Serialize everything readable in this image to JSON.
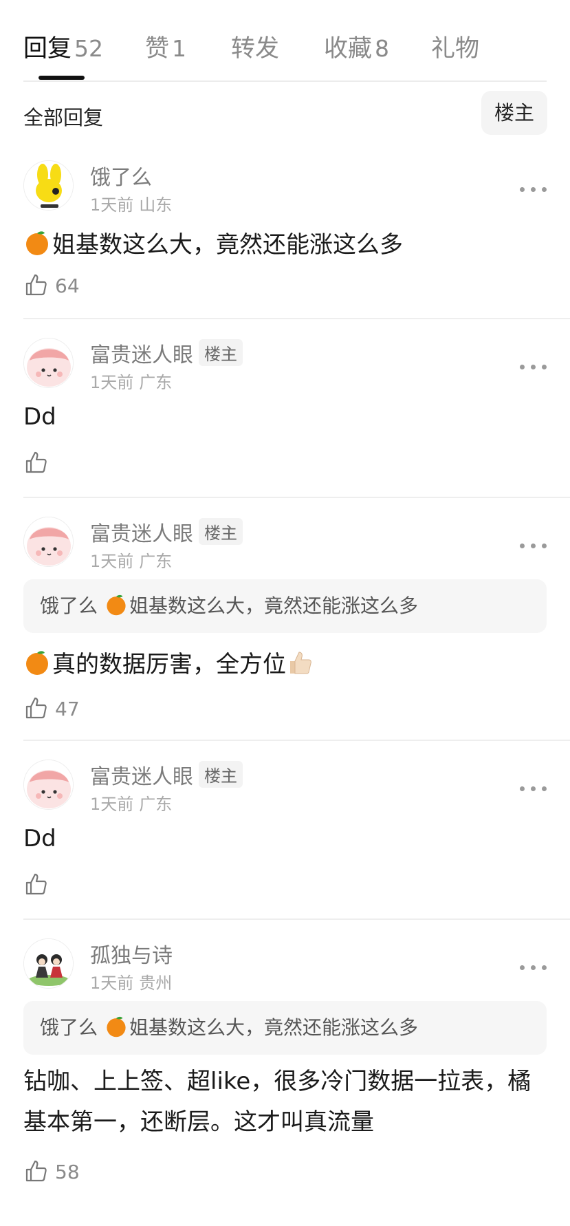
{
  "tabs": [
    {
      "label": "回复",
      "count": "52"
    },
    {
      "label": "赞",
      "count": "1"
    },
    {
      "label": "转发",
      "count": ""
    },
    {
      "label": "收藏",
      "count": "8"
    },
    {
      "label": "礼物",
      "count": ""
    }
  ],
  "filter": {
    "all_label": "全部回复",
    "owner_label": "楼主"
  },
  "comments": [
    {
      "username": "饿了么",
      "time": "1天前",
      "region": "山东",
      "avatar": "yellow-rabbit-avatar",
      "text": "姐基数这么大，竟然还能涨这么多",
      "likes": "64"
    },
    {
      "username": "富贵迷人眼",
      "badge": "楼主",
      "time": "1天前",
      "region": "广东",
      "avatar": "pink-mochi-avatar",
      "text": "Dd",
      "likes": ""
    },
    {
      "username": "富贵迷人眼",
      "badge": "楼主",
      "time": "1天前",
      "region": "广东",
      "avatar": "pink-mochi-avatar",
      "quote_user": "饿了么",
      "quote_text": "姐基数这么大，竟然还能涨这么多",
      "text": "真的数据厉害，全方位",
      "likes": "47"
    },
    {
      "username": "富贵迷人眼",
      "badge": "楼主",
      "time": "1天前",
      "region": "广东",
      "avatar": "pink-mochi-avatar",
      "text": "Dd",
      "likes": ""
    },
    {
      "username": "孤独与诗",
      "time": "1天前",
      "region": "贵州",
      "avatar": "couple-illustration-avatar",
      "quote_user": "饿了么",
      "quote_text": "姐基数这么大，竟然还能涨这么多",
      "text": "钻咖、上上签、超like，很多冷门数据一拉表，橘基本第一，还断层。这才叫真流量",
      "likes": "58"
    }
  ],
  "colors": {
    "text_primary": "#1a1a1a",
    "text_secondary": "#7b7b7b",
    "text_meta": "#a9a9a9",
    "quote_bg": "#f6f6f6",
    "divider": "#eeeeee",
    "tab_indicator": "#111111"
  }
}
